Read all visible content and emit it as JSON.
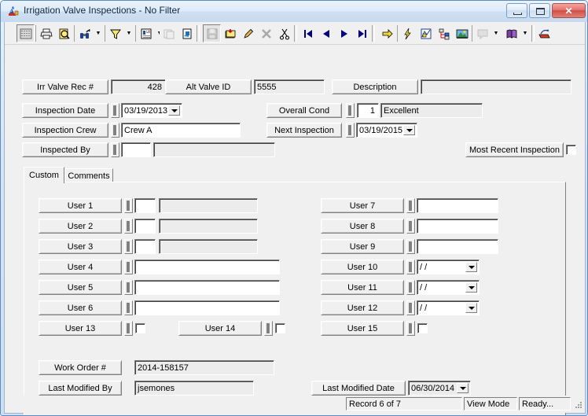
{
  "window": {
    "title": "Irrigation Valve Inspections - No Filter",
    "icon": "irrigation-valve-icon",
    "minimize_label": "Minimize",
    "maximize_label": "Maximize",
    "close_label": "✕"
  },
  "toolbar": {
    "buttons": [
      {
        "name": "grid-view-button",
        "icon": "grid-icon",
        "state": "sunken"
      },
      {
        "name": "print-button",
        "icon": "printer-icon",
        "state": "normal"
      },
      {
        "name": "print-preview-button",
        "icon": "preview-icon",
        "state": "normal"
      },
      {
        "name": "find-button",
        "icon": "binoculars-icon",
        "state": "normal"
      },
      {
        "name": "filter-button",
        "icon": "funnel-icon",
        "state": "normal"
      },
      {
        "name": "report-button",
        "icon": "report-icon",
        "state": "normal"
      },
      {
        "name": "copy-record-button",
        "icon": "copy-record-icon",
        "state": "disabled"
      },
      {
        "name": "paste-record-button",
        "icon": "paste-record-icon",
        "state": "normal"
      },
      {
        "name": "save-button",
        "icon": "save-disk-icon",
        "state": "disabled"
      },
      {
        "name": "new-record-button",
        "icon": "new-record-icon",
        "state": "normal"
      },
      {
        "name": "edit-record-button",
        "icon": "pencil-icon",
        "state": "normal"
      },
      {
        "name": "delete-record-button",
        "icon": "delete-x-icon",
        "state": "disabled"
      },
      {
        "name": "cut-button",
        "icon": "scissors-icon",
        "state": "normal"
      },
      {
        "name": "first-record-button",
        "icon": "first-record-icon",
        "state": "normal"
      },
      {
        "name": "prev-record-button",
        "icon": "prev-record-icon",
        "state": "normal"
      },
      {
        "name": "next-record-button",
        "icon": "next-record-icon",
        "state": "normal"
      },
      {
        "name": "last-record-button",
        "icon": "last-record-icon",
        "state": "normal"
      },
      {
        "name": "goto-button",
        "icon": "yellow-arrow-icon",
        "state": "normal"
      },
      {
        "name": "quick-action-button",
        "icon": "lightning-icon",
        "state": "normal"
      },
      {
        "name": "map-button",
        "icon": "map-icon",
        "state": "normal"
      },
      {
        "name": "hierarchy-button",
        "icon": "hierarchy-icon",
        "state": "normal"
      },
      {
        "name": "image-button",
        "icon": "image-icon",
        "state": "normal"
      },
      {
        "name": "comment-button",
        "icon": "comment-icon",
        "state": "disabled"
      },
      {
        "name": "help-button",
        "icon": "book-icon",
        "state": "normal"
      },
      {
        "name": "exit-button",
        "icon": "exit-icon",
        "state": "normal"
      }
    ]
  },
  "header": {
    "irr_valve_rec_label": "Irr Valve Rec #",
    "irr_valve_rec_value": "428",
    "alt_valve_id_label": "Alt Valve ID",
    "alt_valve_id_value": "5555",
    "description_label": "Description",
    "description_value": "",
    "inspection_date_label": "Inspection Date",
    "inspection_date_value": "03/19/2013",
    "overall_cond_label": "Overall Cond",
    "overall_cond_code": "1",
    "overall_cond_text": "Excellent",
    "inspection_crew_label": "Inspection Crew",
    "inspection_crew_value": "Crew A",
    "next_inspection_label": "Next Inspection",
    "next_inspection_value": "03/19/2015",
    "inspected_by_label": "Inspected By",
    "inspected_by_code": "",
    "inspected_by_text": "",
    "most_recent_inspection_label": "Most Recent Inspection",
    "most_recent_inspection_checked": false
  },
  "tabs": [
    {
      "label": "Custom",
      "active": true
    },
    {
      "label": "Comments",
      "active": false
    }
  ],
  "custom_tab": {
    "left_fields": [
      {
        "label": "User 1",
        "type": "code-text",
        "code": "",
        "text": ""
      },
      {
        "label": "User 2",
        "type": "code-text",
        "code": "",
        "text": ""
      },
      {
        "label": "User 3",
        "type": "code-text",
        "code": "",
        "text": ""
      },
      {
        "label": "User 4",
        "type": "text",
        "value": ""
      },
      {
        "label": "User 5",
        "type": "text",
        "value": ""
      },
      {
        "label": "User 6",
        "type": "text",
        "value": ""
      }
    ],
    "right_fields": [
      {
        "label": "User 7",
        "type": "text",
        "value": ""
      },
      {
        "label": "User 8",
        "type": "text",
        "value": ""
      },
      {
        "label": "User 9",
        "type": "text",
        "value": ""
      },
      {
        "label": "User 10",
        "type": "date",
        "value": "/  /"
      },
      {
        "label": "User 11",
        "type": "date",
        "value": "/  /"
      },
      {
        "label": "User 12",
        "type": "date",
        "value": "/  /"
      }
    ],
    "check_fields": [
      {
        "label": "User 13",
        "checked": false
      },
      {
        "label": "User 14",
        "checked": false
      },
      {
        "label": "User 15",
        "checked": false
      }
    ],
    "work_order_label": "Work Order #",
    "work_order_value": "2014-158157",
    "last_modified_by_label": "Last Modified By",
    "last_modified_by_value": "jsemones",
    "last_modified_date_label": "Last Modified Date",
    "last_modified_date_value": "06/30/2014"
  },
  "statusbar": {
    "record": "Record 6 of 7",
    "mode": "View Mode",
    "state": "Ready..."
  },
  "colors": {
    "window_frame": "#5b8bbf",
    "face": "#f0f0f0",
    "field_bg": "#ffffff",
    "field_disabled_bg": "#ececec",
    "accent_yellow": "#ffd700",
    "accent_blue": "#000080"
  }
}
